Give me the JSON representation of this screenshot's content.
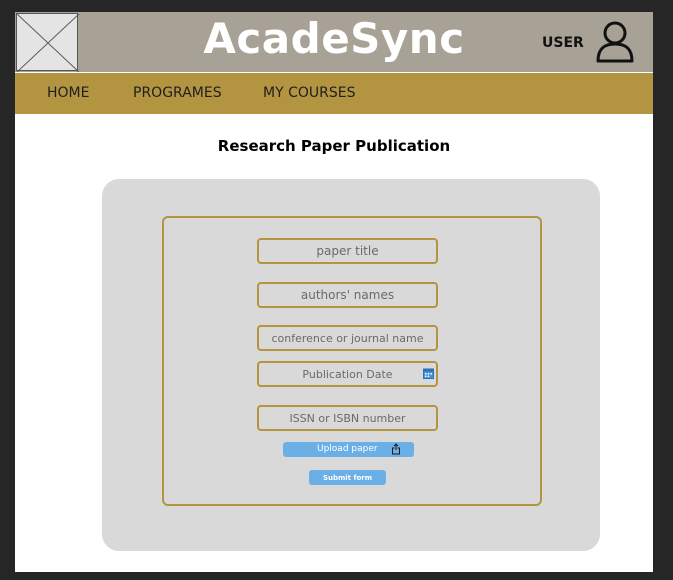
{
  "header": {
    "brand": "AcadeSync",
    "user_label": "USER",
    "logo_icon": "image-placeholder-icon",
    "user_icon": "user-avatar-icon"
  },
  "nav": {
    "items": [
      {
        "label": "HOME"
      },
      {
        "label": "PROGRAMES"
      },
      {
        "label": "MY COURSES"
      }
    ]
  },
  "page": {
    "title": "Research Paper Publication"
  },
  "form": {
    "paper_title_placeholder": "paper title",
    "authors_placeholder": "authors' names",
    "conference_placeholder": "conference or journal name",
    "date_placeholder": "Publication Date",
    "issn_placeholder": "ISSN or ISBN number",
    "upload_label": "Upload paper",
    "submit_label": "Submit form",
    "calendar_icon": "calendar-icon",
    "upload_icon": "share-upload-icon"
  },
  "colors": {
    "header_bg": "#a8a296",
    "nav_bg": "#b39440",
    "panel_bg": "#d9d9d9",
    "accent_border": "#b39440",
    "button_bg": "#6aafe6"
  }
}
